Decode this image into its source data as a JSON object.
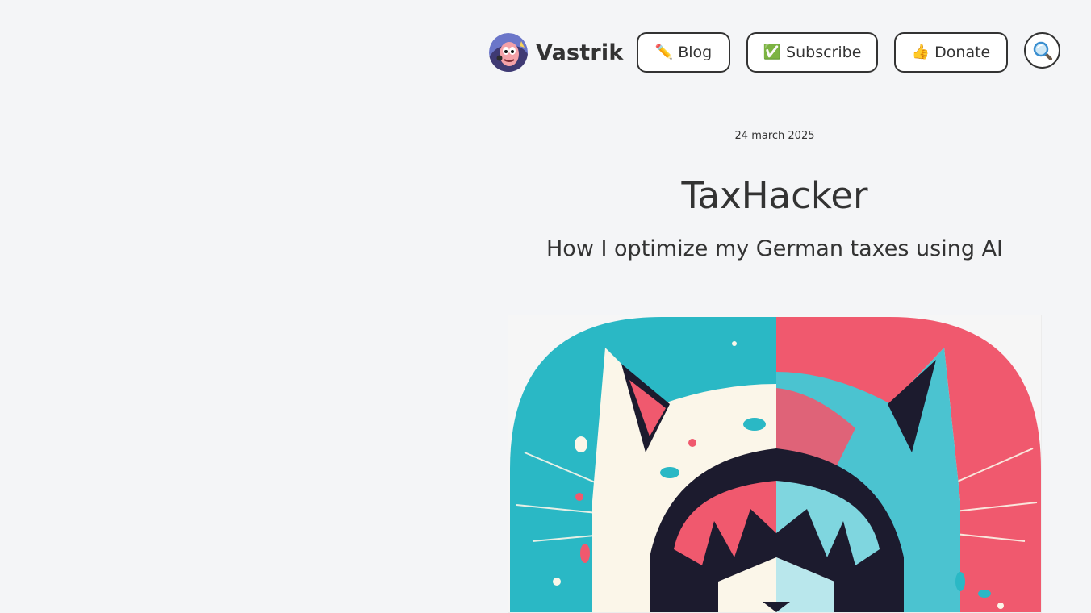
{
  "header": {
    "logo_text": "Vastrik",
    "nav": {
      "blog": {
        "emoji": "✏️",
        "label": "Blog"
      },
      "subscribe": {
        "emoji": "✅",
        "label": "Subscribe"
      },
      "donate": {
        "emoji": "👍",
        "label": "Donate"
      }
    },
    "search_icon": "magnifier-icon"
  },
  "post": {
    "date": "24 march 2025",
    "title": "TaxHacker",
    "subtitle": "How I optimize my German taxes using AI",
    "cover_image": "hooded-cat-hacker-illustration"
  },
  "colors": {
    "background": "#f4f5f7",
    "text": "#333333",
    "cover_teal": "#2ab8c5",
    "cover_pink": "#f0596e",
    "cover_cream": "#fbf6e9",
    "cover_dark": "#1c1b2e"
  }
}
